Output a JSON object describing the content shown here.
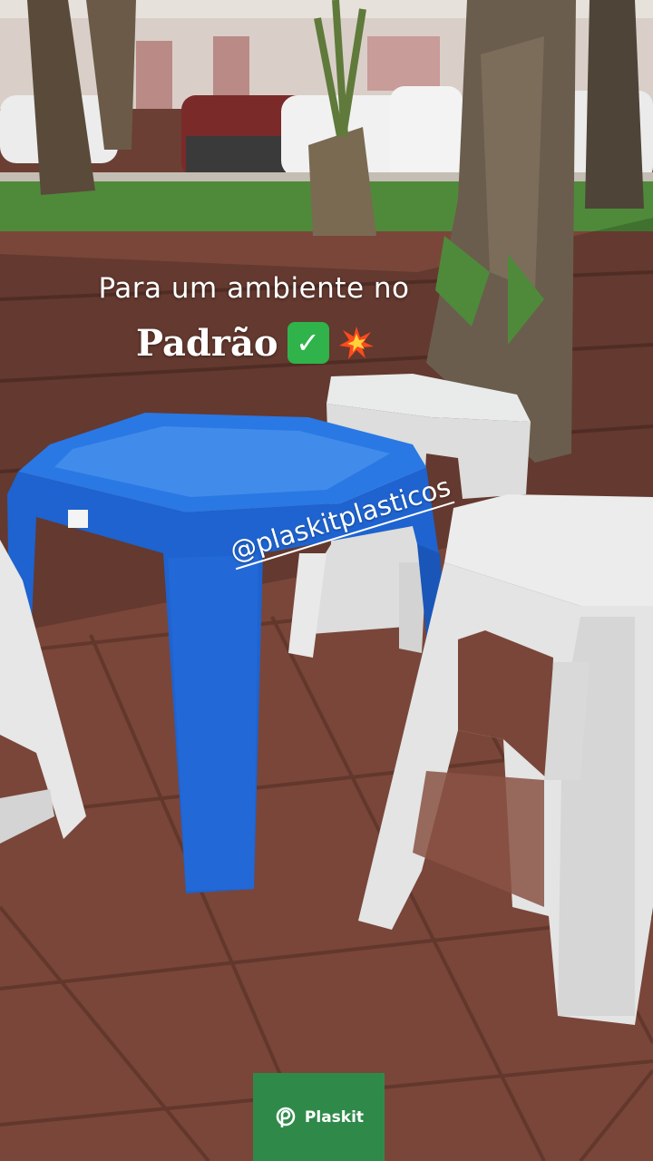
{
  "caption": {
    "line1": "Para um ambiente no",
    "line2": "Padrão",
    "icons": [
      "check-mark-icon",
      "collision-spark-icon"
    ]
  },
  "watermark": {
    "handle": "@plaskitplasticos"
  },
  "brand": {
    "name": "Plaskit",
    "icon": "plaskit-logo-icon",
    "color": "#2f8a4a"
  },
  "colors": {
    "table": "#1e63cf",
    "stools": "#e6e7e6",
    "pavers": "#7a463a",
    "grass": "#4f8a3a"
  }
}
